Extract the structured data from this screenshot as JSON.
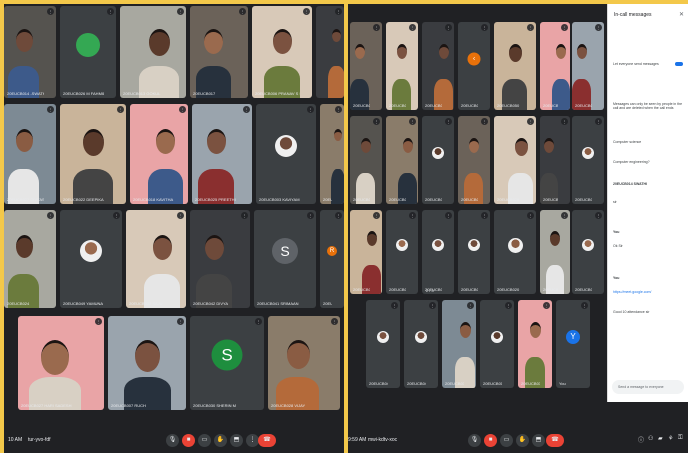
{
  "left_meeting": {
    "participants": [
      {
        "name": "20EUCB014 -SWATHI"
      },
      {
        "name": "20EUCB026 M FAHMIDA B"
      },
      {
        "name": "20EUCB013 GOKUL"
      },
      {
        "name": "20EUCB017"
      },
      {
        "name": "20EUCB006 PRANAV S S"
      },
      {
        "name": ""
      },
      {
        "name": "20EUCB027 DIVYASRI"
      },
      {
        "name": "20EUCB022 DEEPIKA"
      },
      {
        "name": "20EUCB018 KAVITHA"
      },
      {
        "name": "20EUCB025 PREETHI"
      },
      {
        "name": "20EUCB003 KAVIYAM"
      },
      {
        "name": "20EUCB031"
      },
      {
        "name": "20EUCB024"
      },
      {
        "name": "20EUCB049 YAMUNA"
      },
      {
        "name": "20EUCB032 SAJU"
      },
      {
        "name": "20EUCB042 DIVYA"
      },
      {
        "name": "20EUCB041 SRIMAAN"
      },
      {
        "name": "20EUCB038"
      },
      {
        "name": "20EUCB027 HARI SADESH"
      },
      {
        "name": "20EUCB007 RUCH"
      },
      {
        "name": "20EUCB030 SHERIN M"
      },
      {
        "name": "20EUCB028 VIJAY"
      }
    ],
    "meeting_time": "10 AM",
    "meeting_code": "tur-yvo-fdf",
    "avatar_s": "S",
    "avatar_r": "R"
  },
  "right_meeting": {
    "participants": [
      {
        "name": "20EUCB040"
      },
      {
        "name": "20EUCB039"
      },
      {
        "name": "20EUCB035"
      },
      {
        "name": "20EUCB043 S"
      },
      {
        "name": "20EUCB050"
      },
      {
        "name": "20EUCB016"
      },
      {
        "name": "20EUCB011"
      },
      {
        "name": "20EUCB048"
      },
      {
        "name": "20EUCB002"
      },
      {
        "name": "20EUCB045"
      },
      {
        "name": "20EUCB009"
      },
      {
        "name": "20EUCB029"
      },
      {
        "name": "20EUCB010"
      },
      {
        "name": "20EUCB019"
      },
      {
        "name": "20EUCB004"
      },
      {
        "name": "20EUCB001"
      },
      {
        "name": "20EUCB047"
      },
      {
        "name": "20EUCB012"
      },
      {
        "name": "20EUCB020"
      },
      {
        "name": "20EUCB023"
      },
      {
        "name": "20EUCB037"
      },
      {
        "name": "20EUCB046"
      },
      {
        "name": "20EUCB044"
      },
      {
        "name": "20EUCB033"
      },
      {
        "name": "20EUCB015"
      },
      {
        "name": "20EUCB036"
      },
      {
        "name": "You"
      }
    ],
    "meeting_time": "9:59 AM",
    "meeting_code": "mwi-kdtv-xoc",
    "avatar_you": "Y",
    "avatar_arrow": "‹",
    "pager": "2/3"
  },
  "chat": {
    "title": "In-call messages",
    "toggle_label": "Let everyone send messages",
    "notice": "Messages can only be seen by people in the call and are deleted when the call ends",
    "messages": [
      "Computer science",
      "Computer engineering?",
      "20EUCB014 SWATHI",
      "sir",
      "You",
      "Ok Sir",
      "You",
      "https://meet.google.com/",
      "Good 10 attendance sir"
    ],
    "input_placeholder": "Send a message to everyone"
  },
  "colors": {
    "screen_bg": "#202124",
    "tile_bg": "#3c4043",
    "end_call": "#ea4335",
    "accent": "#1a73e8",
    "border": "#f3c84a"
  }
}
